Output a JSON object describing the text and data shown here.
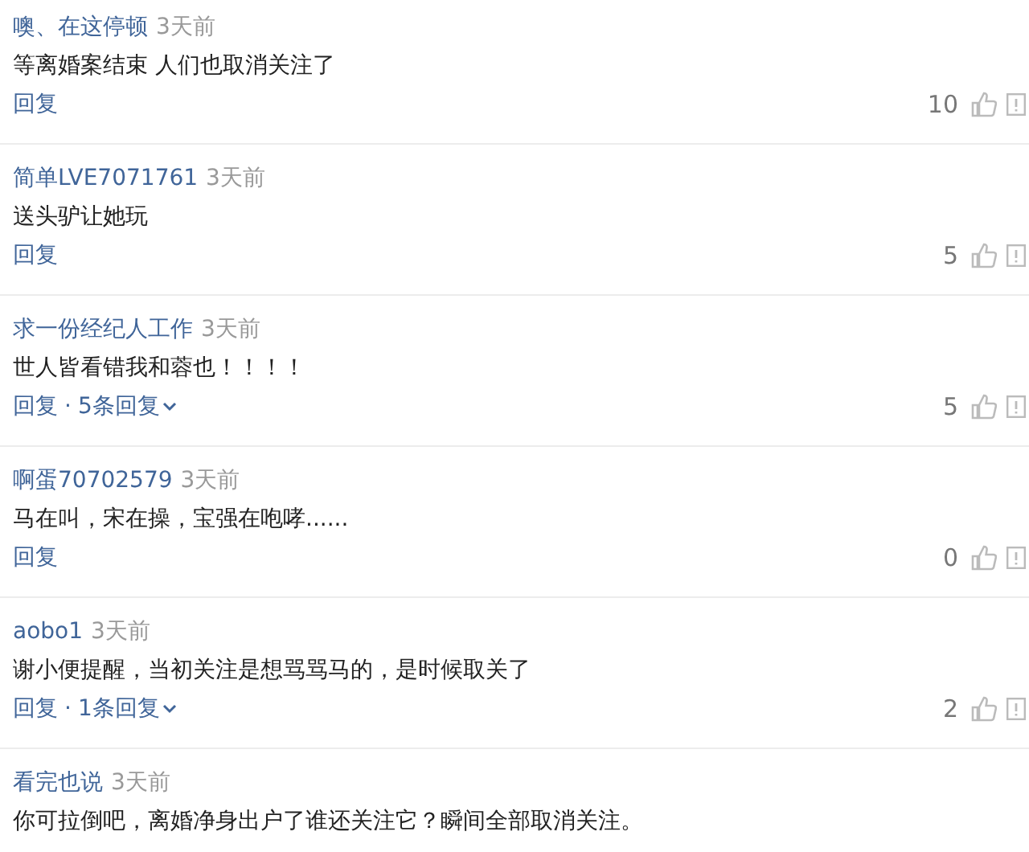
{
  "comments": [
    {
      "author": "噢、在这停顿",
      "time": "3天前",
      "text": "等离婚案结束 人们也取消关注了",
      "actions": {
        "reply": "回复",
        "likes": "10"
      }
    },
    {
      "author": "简单LVE7071761",
      "time": "3天前",
      "text": "送头驴让她玩",
      "actions": {
        "reply": "回复",
        "likes": "5"
      }
    },
    {
      "author": "求一份经纪人工作",
      "time": "3天前",
      "text": "世人皆看错我和蓉也！！！！",
      "actions": {
        "reply": "回复",
        "separator": "·",
        "replies": "5条回复",
        "likes": "5"
      }
    },
    {
      "author": "啊蛋70702579",
      "time": "3天前",
      "text": "马在叫，宋在操，宝强在咆哮......",
      "actions": {
        "reply": "回复",
        "likes": "0"
      }
    },
    {
      "author": "aobo1",
      "time": "3天前",
      "text": "谢小便提醒，当初关注是想骂骂马的，是时候取关了",
      "actions": {
        "reply": "回复",
        "separator": "·",
        "replies": "1条回复",
        "likes": "2"
      }
    },
    {
      "author": "看完也说",
      "time": "3天前",
      "text": "你可拉倒吧，离婚净身出户了谁还关注它？瞬间全部取消关注。"
    }
  ]
}
